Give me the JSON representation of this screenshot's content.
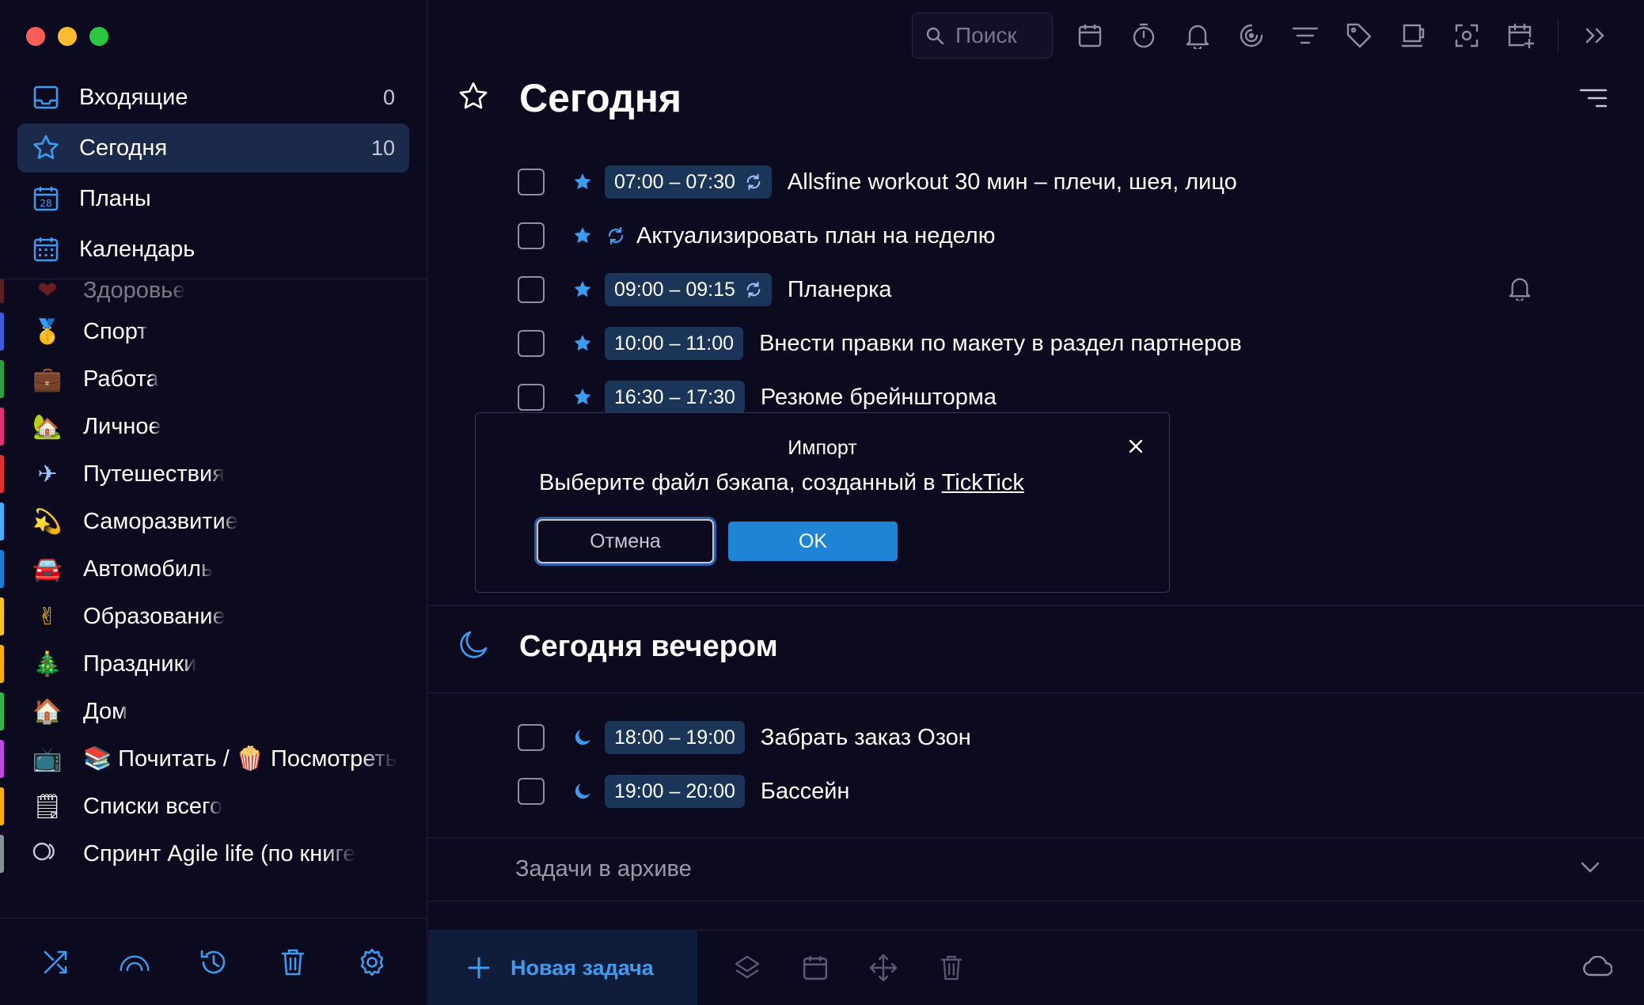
{
  "window": {
    "controls": [
      "close",
      "minimize",
      "zoom"
    ]
  },
  "colors": {
    "accent": "#3a9cf2",
    "background": "#0c0a1e",
    "active_item": "#1b2a4a",
    "time_badge": "#1b3558",
    "ok_button": "#1f84d6"
  },
  "sidebar": {
    "smart_lists": [
      {
        "label": "Входящие",
        "count": "0",
        "icon": "inbox-icon"
      },
      {
        "label": "Сегодня",
        "count": "10",
        "icon": "star-icon",
        "active": true
      },
      {
        "label": "Планы",
        "count": "",
        "icon": "calendar-28-icon"
      },
      {
        "label": "Календарь",
        "count": "",
        "icon": "calendar-grid-icon"
      }
    ],
    "lists": [
      {
        "label": "Здоровье",
        "emoji": "❤",
        "color": "#c0392b"
      },
      {
        "label": "Спорт",
        "emoji": "🥇",
        "color": "#3b5bdb"
      },
      {
        "label": "Работа",
        "emoji": "💼",
        "color": "#2f9e44"
      },
      {
        "label": "Личное",
        "emoji": "🏡",
        "color": "#e03170"
      },
      {
        "label": "Путешествия",
        "emoji": "✈",
        "color": "#e03131"
      },
      {
        "label": "Саморазвитие",
        "emoji": "💫",
        "color": "#4dabf7"
      },
      {
        "label": "Автомобиль",
        "emoji": "🚘",
        "color": "#1c7ed6"
      },
      {
        "label": "Образование",
        "emoji": "✌",
        "color": "#fcc419"
      },
      {
        "label": "Праздники",
        "emoji": "🎄",
        "color": "#fab005"
      },
      {
        "label": "Дом",
        "emoji": "🏠",
        "color": "#37b24d"
      },
      {
        "label": "📚 Почитать / 🍿 Посмотреть",
        "emoji": "📺",
        "color": "#be4bdb"
      },
      {
        "label": "Списки всего",
        "emoji": "🗒",
        "color": "#fab005"
      },
      {
        "label": "Спринт Agile life (по книге",
        "emoji": "◯",
        "color": "#868e96"
      }
    ],
    "bottom_icons": [
      "shuffle-icon",
      "gauge-icon",
      "history-icon",
      "trash-icon",
      "settings-icon"
    ]
  },
  "toolbar": {
    "search_placeholder": "Поиск",
    "icons": [
      "calendar-icon",
      "timer-icon",
      "bell-icon",
      "focus-icon",
      "filter-icon",
      "tag-icon",
      "mug-icon",
      "screenshot-icon",
      "add-calendar-icon",
      "expand-icon"
    ]
  },
  "main": {
    "title": "Сегодня",
    "tasks": [
      {
        "time": "07:00 – 07:30",
        "repeat": true,
        "title": "Allsfine workout 30 мин – плечи, шея, лицо",
        "bell": false
      },
      {
        "time": "",
        "repeat": true,
        "title": "Актуализировать план на неделю",
        "bell": false
      },
      {
        "time": "09:00 – 09:15",
        "repeat": true,
        "title": "Планерка",
        "bell": true
      },
      {
        "time": "10:00 – 11:00",
        "repeat": false,
        "title": "Внести правки по макету в раздел партнеров",
        "bell": false
      },
      {
        "time": "16:30 – 17:30",
        "repeat": false,
        "title": "Резюме брейншторма",
        "bell": false
      }
    ],
    "evening": {
      "title": "Сегодня вечером",
      "tasks": [
        {
          "time": "18:00 – 19:00",
          "title": "Забрать заказ Озон"
        },
        {
          "time": "19:00 – 20:00",
          "title": "Бассейн"
        }
      ]
    },
    "archive_label": "Задачи в архиве",
    "new_task_label": "Новая задача"
  },
  "dialog": {
    "title": "Импорт",
    "message": "Выберите файл бэкапа, созданный в ",
    "link": "TickTick",
    "cancel_label": "Отмена",
    "ok_label": "OK"
  }
}
